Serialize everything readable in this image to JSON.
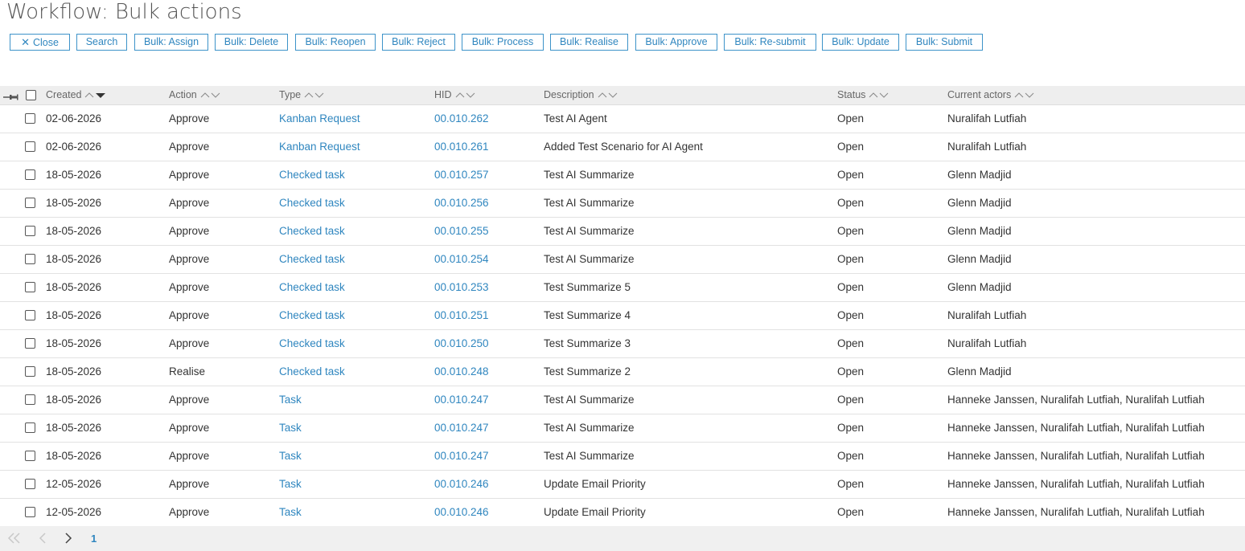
{
  "page": {
    "title": "Workflow: Bulk actions"
  },
  "toolbar": {
    "buttons": [
      {
        "label": "Close",
        "icon": "close-icon"
      },
      {
        "label": "Search"
      },
      {
        "label": "Bulk: Assign"
      },
      {
        "label": "Bulk: Delete"
      },
      {
        "label": "Bulk: Reopen"
      },
      {
        "label": "Bulk: Reject"
      },
      {
        "label": "Bulk: Process"
      },
      {
        "label": "Bulk: Realise"
      },
      {
        "label": "Bulk: Approve"
      },
      {
        "label": "Bulk: Re-submit"
      },
      {
        "label": "Bulk: Update"
      },
      {
        "label": "Bulk: Submit"
      }
    ]
  },
  "grid": {
    "columns": [
      "Created",
      "Action",
      "Type",
      "HID",
      "Description",
      "Status",
      "Current actors"
    ],
    "sorted_column": "Created",
    "sort_direction": "descending",
    "rows": [
      [
        "02-06-2026",
        "Approve",
        "Kanban Request",
        "00.010.262",
        "Test AI Agent",
        "Open",
        "Nuralifah Lutfiah"
      ],
      [
        "02-06-2026",
        "Approve",
        "Kanban Request",
        "00.010.261",
        "Added Test Scenario for AI Agent",
        "Open",
        "Nuralifah Lutfiah"
      ],
      [
        "18-05-2026",
        "Approve",
        "Checked task",
        "00.010.257",
        "Test AI Summarize",
        "Open",
        "Glenn Madjid"
      ],
      [
        "18-05-2026",
        "Approve",
        "Checked task",
        "00.010.256",
        "Test AI Summarize",
        "Open",
        "Glenn Madjid"
      ],
      [
        "18-05-2026",
        "Approve",
        "Checked task",
        "00.010.255",
        "Test AI Summarize",
        "Open",
        "Glenn Madjid"
      ],
      [
        "18-05-2026",
        "Approve",
        "Checked task",
        "00.010.254",
        "Test AI Summarize",
        "Open",
        "Glenn Madjid"
      ],
      [
        "18-05-2026",
        "Approve",
        "Checked task",
        "00.010.253",
        "Test Summarize 5",
        "Open",
        "Glenn Madjid"
      ],
      [
        "18-05-2026",
        "Approve",
        "Checked task",
        "00.010.251",
        "Test Summarize 4",
        "Open",
        "Nuralifah Lutfiah"
      ],
      [
        "18-05-2026",
        "Approve",
        "Checked task",
        "00.010.250",
        "Test Summarize 3",
        "Open",
        "Nuralifah Lutfiah"
      ],
      [
        "18-05-2026",
        "Realise",
        "Checked task",
        "00.010.248",
        "Test Summarize 2",
        "Open",
        "Glenn Madjid"
      ],
      [
        "18-05-2026",
        "Approve",
        "Task",
        "00.010.247",
        "Test AI Summarize",
        "Open",
        "Hanneke Janssen, Nuralifah Lutfiah, Nuralifah Lutfiah"
      ],
      [
        "18-05-2026",
        "Approve",
        "Task",
        "00.010.247",
        "Test AI Summarize",
        "Open",
        "Hanneke Janssen, Nuralifah Lutfiah, Nuralifah Lutfiah"
      ],
      [
        "18-05-2026",
        "Approve",
        "Task",
        "00.010.247",
        "Test AI Summarize",
        "Open",
        "Hanneke Janssen, Nuralifah Lutfiah, Nuralifah Lutfiah"
      ],
      [
        "12-05-2026",
        "Approve",
        "Task",
        "00.010.246",
        "Update Email Priority",
        "Open",
        "Hanneke Janssen, Nuralifah Lutfiah, Nuralifah Lutfiah"
      ],
      [
        "12-05-2026",
        "Approve",
        "Task",
        "00.010.246",
        "Update Email Priority",
        "Open",
        "Hanneke Janssen, Nuralifah Lutfiah, Nuralifah Lutfiah"
      ]
    ]
  },
  "pager": {
    "current_page": "1"
  },
  "colors": {
    "accent": "#2f86bf",
    "header_bg": "#eeeeee",
    "pager_bg": "#f0f0f0"
  }
}
